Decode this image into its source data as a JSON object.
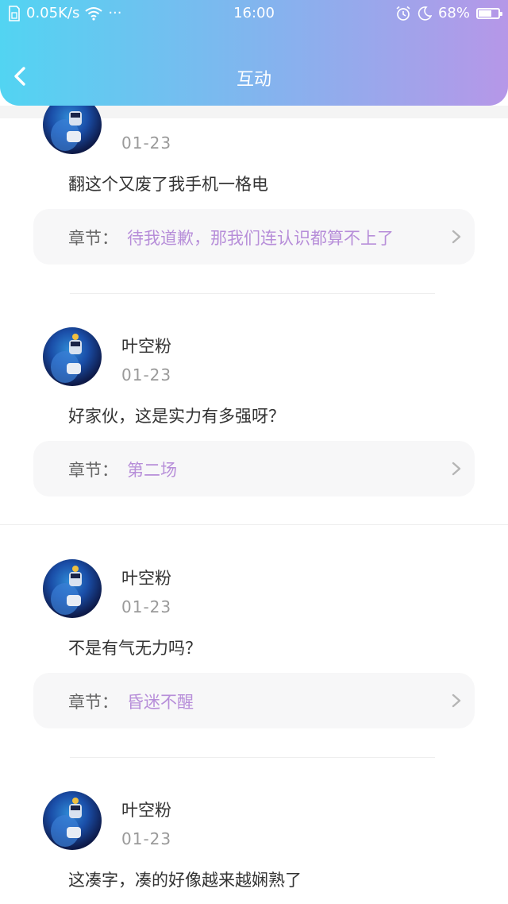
{
  "status": {
    "speed": "0.05K/s",
    "dots": "···",
    "time": "16:00",
    "battery_pct": "68%",
    "battery_level": 0.68
  },
  "nav": {
    "title": "互动"
  },
  "comments": [
    {
      "date": "01-23",
      "text": "翻这个又废了我手机一格电",
      "chapter_label": "章节：",
      "chapter": "待我道歉，那我们连认识都算不上了"
    },
    {
      "name": "叶空粉",
      "date": "01-23",
      "text": "好家伙，这是实力有多强呀？",
      "chapter_label": "章节：",
      "chapter": "第二场"
    },
    {
      "name": "叶空粉",
      "date": "01-23",
      "text": "不是有气无力吗？",
      "chapter_label": "章节：",
      "chapter": "昏迷不醒"
    },
    {
      "name": "叶空粉",
      "date": "01-23",
      "text": "这凑字，凑的好像越来越娴熟了"
    }
  ],
  "icons": {
    "back": "chevron-left-icon",
    "chapter_arrow": "chevron-right-icon",
    "alarm": "alarm-icon",
    "moon": "moon-icon",
    "wifi": "wifi-icon",
    "sim": "sim-icon",
    "battery": "battery-icon"
  }
}
